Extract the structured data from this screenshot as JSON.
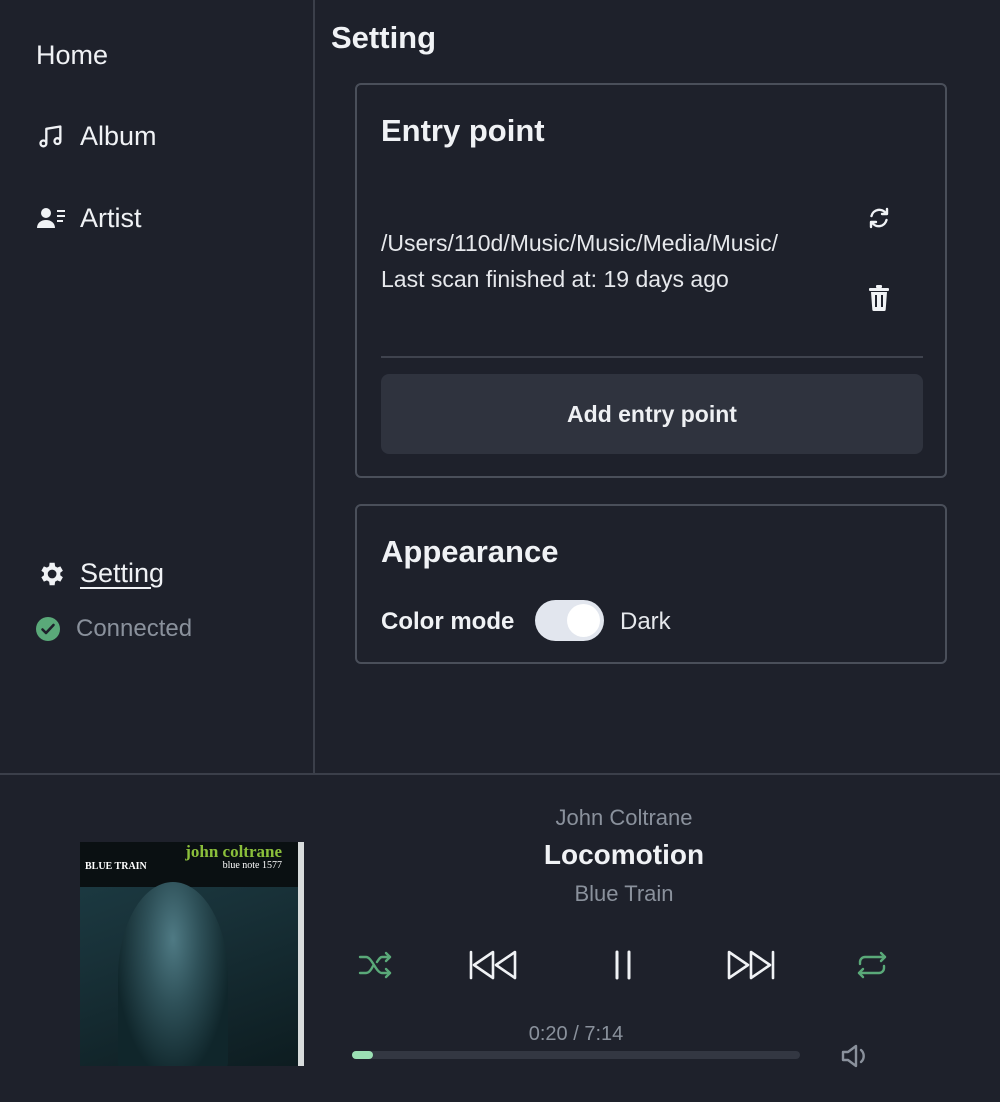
{
  "sidebar": {
    "items": [
      {
        "label": "Home",
        "icon": "home"
      },
      {
        "label": "Album",
        "icon": "music-note-icon"
      },
      {
        "label": "Artist",
        "icon": "artist-list-icon"
      }
    ],
    "setting_label": "Setting",
    "status_label": "Connected"
  },
  "main": {
    "title": "Setting",
    "entry_point": {
      "title": "Entry point",
      "path": "/Users/110d/Music/Music/Media/Music/",
      "last_scan": "Last scan finished at: 19 days ago",
      "add_label": "Add entry point"
    },
    "appearance": {
      "title": "Appearance",
      "color_mode_label": "Color mode",
      "color_mode_value": "Dark",
      "dark_enabled": true
    }
  },
  "player": {
    "artist": "John Coltrane",
    "track": "Locomotion",
    "album": "Blue Train",
    "time": "0:20 / 7:14",
    "progress": 0.047,
    "shuffle_on": true,
    "repeat_on": true,
    "cover": {
      "artist_text": "john coltrane",
      "title_text": "BLUE TRAIN",
      "catalog_text": "blue note 1577"
    }
  },
  "colors": {
    "background": "#1e212b",
    "accent_green": "#5aa979",
    "progress_fill": "#9be0b4",
    "muted_text": "#8a919c"
  }
}
